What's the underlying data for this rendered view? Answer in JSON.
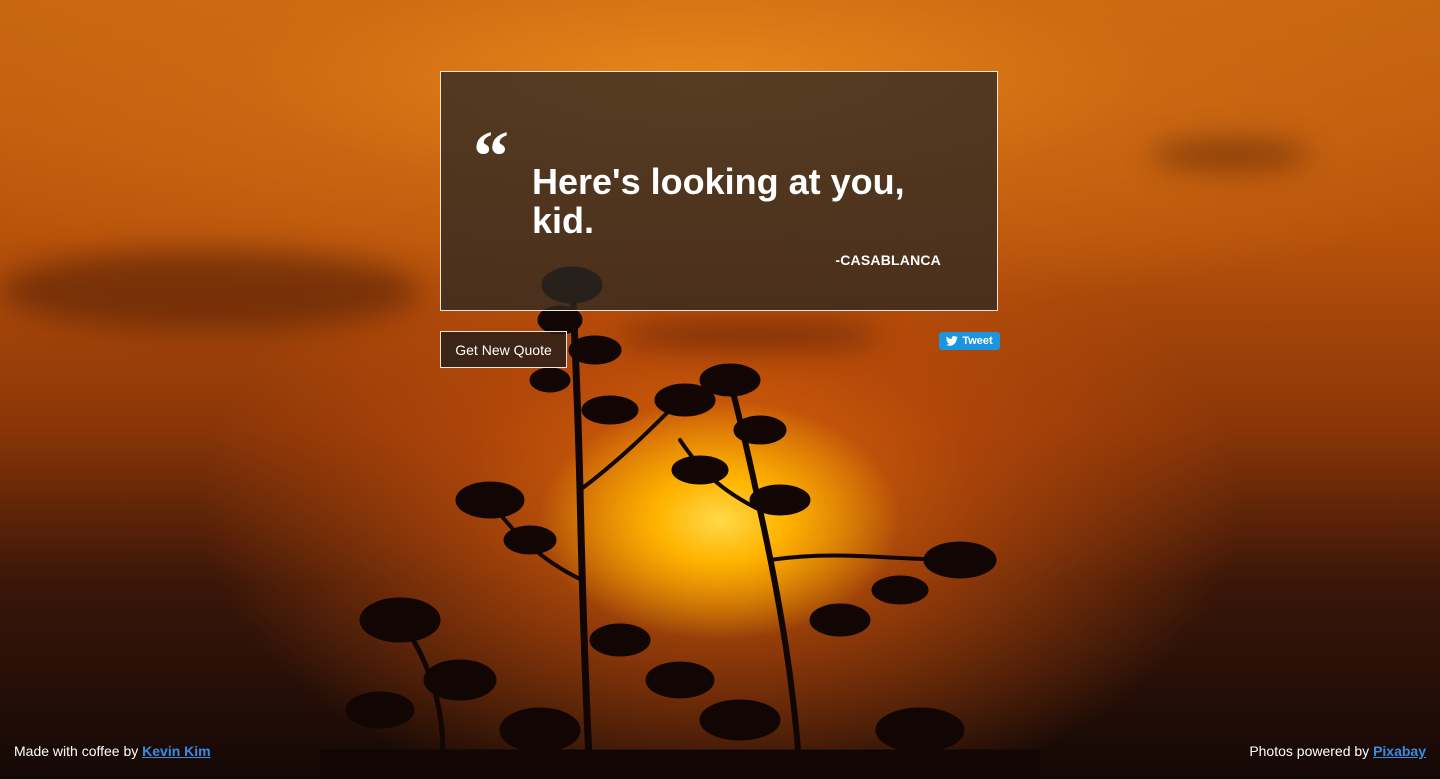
{
  "quote": {
    "mark": "“",
    "text": "Here's looking at you, kid.",
    "author": "-CASABLANCA"
  },
  "actions": {
    "new_quote_label": "Get New Quote",
    "tweet_label": "Tweet"
  },
  "footer": {
    "left_prefix": "Made with coffee by ",
    "left_link": "Kevin Kim",
    "right_prefix": "Photos powered by ",
    "right_link": "Pixabay"
  },
  "colors": {
    "tweet_blue": "#1b95e0",
    "link_blue": "#3a8ce0",
    "sky_orange": "#c7650f"
  },
  "icons": {
    "tweet": "twitter-bird-icon"
  }
}
